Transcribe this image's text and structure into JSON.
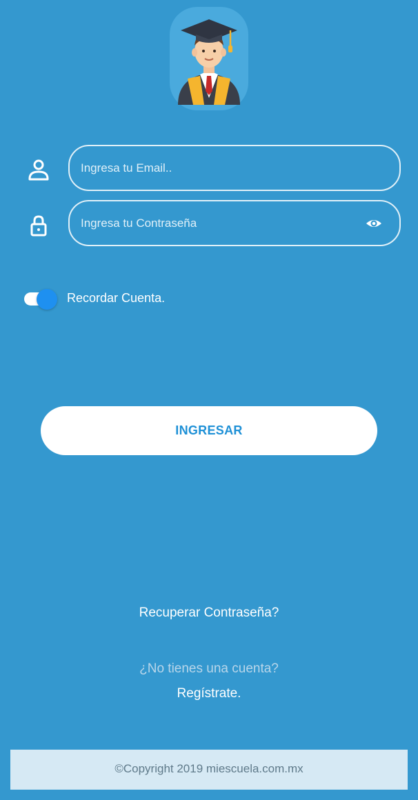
{
  "logo": {
    "icon": "graduate-avatar-icon"
  },
  "email": {
    "icon": "user-icon",
    "placeholder": "Ingresa tu Email..",
    "value": ""
  },
  "password": {
    "icon": "lock-icon",
    "placeholder": "Ingresa tu Contraseña",
    "value": "",
    "toggle_icon": "eye-icon"
  },
  "remember": {
    "label": "Recordar Cuenta.",
    "checked": true
  },
  "login_button": {
    "label": "INGRESAR"
  },
  "recover_link": "Recuperar Contraseña?",
  "no_account_text": "¿No tienes una cuenta?",
  "register_link": "Regístrate.",
  "footer": {
    "text": "©Copyright 2019 miescuela.com.mx"
  },
  "colors": {
    "background": "#3498cf",
    "button_text": "#1e90d6",
    "toggle_thumb": "#1e90f0",
    "footer_bg": "#d6e9f4"
  }
}
